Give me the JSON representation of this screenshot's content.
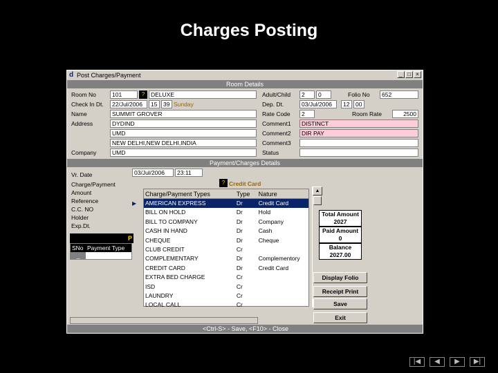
{
  "slide": {
    "title": "Charges Posting"
  },
  "window": {
    "title": "Post Charges/Payment",
    "app_icon": "d",
    "buttons": [
      "_",
      "□",
      "×"
    ]
  },
  "room_details": {
    "band": "Room Details",
    "room_no_label": "Room No",
    "room_no": "101",
    "room_type": "DELUXE",
    "checkin_label": "Check In Dt.",
    "checkin_date": "22/Jul/2006",
    "checkin_hh": "15",
    "checkin_mm": "39",
    "checkin_day": "Sunday",
    "name_label": "Name",
    "name": "SUMMIT GROVER",
    "address_label": "Address",
    "address1": "DYDIND",
    "address2": "UMD",
    "address3": "NEW DELHI,NEW DELHI,INDIA",
    "company_label": "Company",
    "company": "UMD",
    "adult_child_label": "Adult/Child",
    "adult": "2",
    "child": "0",
    "folio_label": "Folio No",
    "folio_no": "652",
    "dep_label": "Dep. Dt.",
    "dep_date": "03/Jul/2006",
    "dep_hh": "12",
    "dep_mm": "00",
    "rate_code_label": "Rate Code",
    "rate_code": "2",
    "room_rate_label": "Room Rate",
    "room_rate": "2500",
    "comment1_label": "Comment1",
    "comment1": "DISTINCT",
    "comment2_label": "Comment2",
    "comment2": "DIR PAY",
    "comment3_label": "Comment3",
    "comment3": "",
    "status_label": "Status",
    "status": ""
  },
  "payment_details": {
    "band": "Payment/Charges Details",
    "vr_date_label": "Vr. Date",
    "vr_date": "03/Jul/2006",
    "vr_time": "23:11",
    "charge_payment_label": "Charge/Payment",
    "charge_payment_value": "Credit Card",
    "amount_label": "Amount",
    "reference_label": "Reference",
    "cc_no_label": "C.C. NO",
    "holder_label": "Holder",
    "exp_dt_label": "Exp.Dt.",
    "side_panel_label": "P",
    "small_grid_headers": [
      "SNo",
      "Payment Type"
    ],
    "small_grid_row": [
      "_",
      ""
    ]
  },
  "lookup": {
    "headers": [
      "Charge/Payment Types",
      "Type",
      "Nature"
    ],
    "rows": [
      [
        "AMERICAN EXPRESS",
        "Dr",
        "Credit Card"
      ],
      [
        "BILL ON HOLD",
        "Dr",
        "Hold"
      ],
      [
        "BILL TO COMPANY",
        "Dr",
        "Company"
      ],
      [
        "CASH IN HAND",
        "Dr",
        "Cash"
      ],
      [
        "CHEQUE",
        "Dr",
        "Cheque"
      ],
      [
        "CLUB CREDIT",
        "Cr",
        ""
      ],
      [
        "COMPLEMENTARY",
        "Dr",
        "Complementory"
      ],
      [
        "CREDIT CARD",
        "Dr",
        "Credit Card"
      ],
      [
        "EXTRA BED CHARGE",
        "Cr",
        ""
      ],
      [
        "ISD",
        "Cr",
        ""
      ],
      [
        "LAUNDRY",
        "Cr",
        ""
      ],
      [
        "LOCAL CALL",
        "Cr",
        ""
      ]
    ],
    "selected_index": 0
  },
  "totals": {
    "total_amount_label": "Total Amount",
    "total_amount": "2027",
    "paid_amount_label": "Paid Amount",
    "paid_amount": "0",
    "balance_label": "Balance",
    "balance": "2027.00"
  },
  "actions": {
    "display_folio": "Display Folio",
    "receipt_print": "Receipt Print",
    "save": "Save",
    "exit": "Exit"
  },
  "status_bar": "<Ctrl-S> - Save, <F10> - Close",
  "nav_buttons": [
    "|◀",
    "◀",
    "▶",
    "▶|"
  ],
  "colors": {
    "pink_field": "#ffccd9",
    "band": "#808080",
    "selection": "#0a246a"
  }
}
